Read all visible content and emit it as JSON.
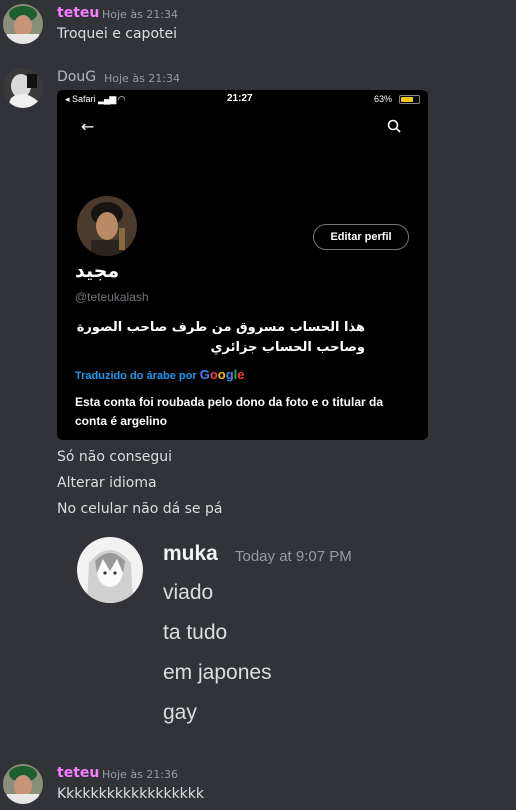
{
  "messages": [
    {
      "author": "teteu",
      "timestamp": "Hoje às 21:34",
      "text": "Troquei e capotei"
    },
    {
      "author": "DouG",
      "timestamp": "Hoje às 21:34"
    },
    {
      "text": "Só não consegui"
    },
    {
      "text": "Alterar idioma"
    },
    {
      "text": "No celular não dá se pá"
    },
    {
      "author": "teteu",
      "timestamp": "Hoje às 21:36",
      "text": "Kkkkkkkkkkkkkkkkkk"
    }
  ],
  "colors": {
    "teteu": "#f47fff",
    "doug": "#b5bac1",
    "background": "#313338",
    "translate_link": "#1d9bf0"
  },
  "phone_screenshot": {
    "status_left": "◂ Safari",
    "time": "21:27",
    "battery": "63%",
    "battery_level": 0.63,
    "back_icon": "arrow-left-icon",
    "search_icon": "search-icon",
    "edit_button": "Editar perfil",
    "display_name": "مجيد",
    "handle": "@teteukalash",
    "bio": "هذا الحساب مسروق من طرف صاحب الصورة وصاحب الحساب جزائري",
    "translated_by": "Traduzido do árabe por",
    "translator": "Google",
    "translation": "Esta conta foi roubada pelo dono da foto e o titular da conta é argelino"
  },
  "quoted_chat": {
    "author": "muka",
    "timestamp": "Today at 9:07 PM",
    "lines": [
      "viado",
      "ta tudo",
      "em japones",
      "gay"
    ]
  }
}
